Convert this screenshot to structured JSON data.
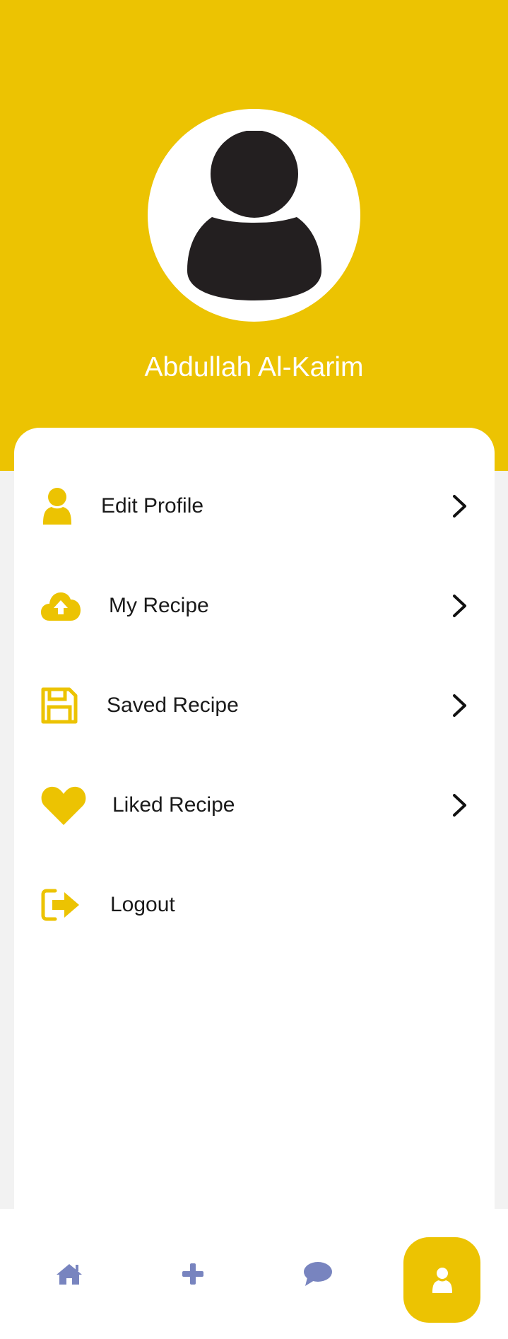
{
  "profile": {
    "name": "Abdullah Al-Karim",
    "avatar_icon": "user-silhouette-icon"
  },
  "menu": {
    "items": [
      {
        "label": "Edit Profile",
        "icon": "user-icon",
        "has_chevron": true
      },
      {
        "label": "My Recipe",
        "icon": "cloud-upload-icon",
        "has_chevron": true
      },
      {
        "label": "Saved Recipe",
        "icon": "floppy-disk-icon",
        "has_chevron": true
      },
      {
        "label": "Liked Recipe",
        "icon": "heart-icon",
        "has_chevron": true
      },
      {
        "label": "Logout",
        "icon": "sign-out-icon",
        "has_chevron": false
      }
    ]
  },
  "bottom_nav": {
    "items": [
      {
        "icon": "home-icon",
        "active": false
      },
      {
        "icon": "plus-icon",
        "active": false
      },
      {
        "icon": "chat-bubble-icon",
        "active": false
      },
      {
        "icon": "user-icon",
        "active": true
      }
    ]
  },
  "colors": {
    "accent": "#ecc302",
    "nav_icon": "#7884bf",
    "background": "#f2f2f2",
    "card": "#ffffff",
    "text": "#1a1a1a",
    "avatar_figure": "#231f20"
  }
}
